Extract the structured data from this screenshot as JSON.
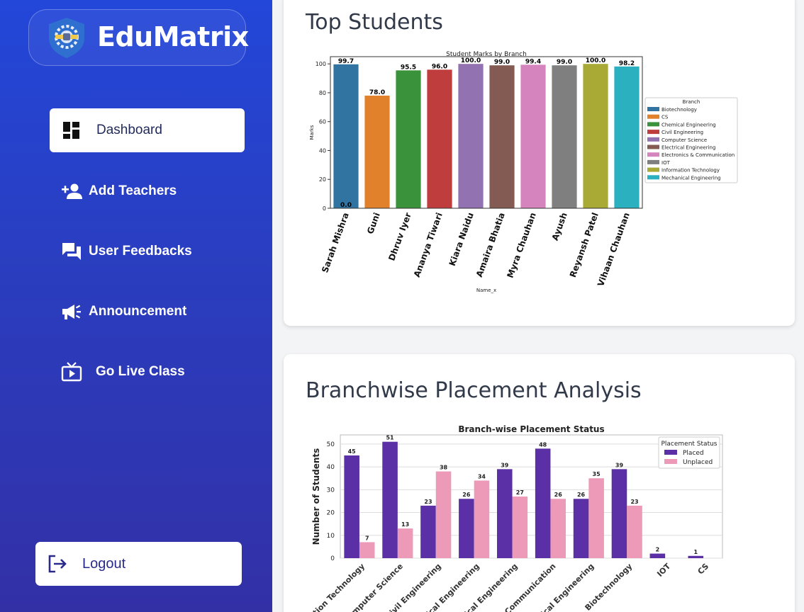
{
  "app": {
    "name": "EduMatrix"
  },
  "sidebar": {
    "items": [
      {
        "label": "Dashboard",
        "icon": "dashboard-icon"
      },
      {
        "label": "Add Teachers",
        "icon": "add-person-icon"
      },
      {
        "label": "User Feedbacks",
        "icon": "chat-icon"
      },
      {
        "label": "Announcement",
        "icon": "megaphone-icon"
      },
      {
        "label": "Go Live Class",
        "icon": "live-tv-icon"
      }
    ],
    "logout_label": "Logout"
  },
  "sections": {
    "top_students_title": "Top Students",
    "placement_title": "Branchwise Placement Analysis"
  },
  "colors": {
    "placed": "#5b30a6",
    "unplaced": "#ec9ab8",
    "sidebar_top": "#2347d9",
    "sidebar_bottom": "#3330a6"
  },
  "chart_data": [
    {
      "type": "bar",
      "title": "Student Marks by Branch",
      "xlabel": "Name_x",
      "ylabel": "Marks",
      "ylim": [
        0,
        105
      ],
      "yticks": [
        0,
        20,
        40,
        60,
        80,
        100
      ],
      "categories": [
        "Sarah Mishra",
        "Guni",
        "Dhruv Iyer",
        "Ananya Tiwari",
        "Kiara Naidu",
        "Amaira Bhatia",
        "Myra Chauhan",
        "Ayush",
        "Reyansh Patel",
        "Vihaan Chauhan"
      ],
      "values": [
        99.7,
        78.0,
        95.5,
        96.0,
        100.0,
        99.0,
        99.4,
        99.0,
        100.0,
        98.2
      ],
      "value_labels": [
        "99.7",
        "78.0",
        "95.5",
        "96.0",
        "100.0",
        "99.0",
        "99.4",
        "99.0",
        "100.0",
        "98.2"
      ],
      "extra_label": "0.0",
      "legend_title": "Branch",
      "legend_position": "right",
      "series_colors": [
        "#3174a1",
        "#e1812c",
        "#3a923a",
        "#c03d3e",
        "#9372b2",
        "#845b53",
        "#d684bd",
        "#7f7f7f",
        "#a9aa35",
        "#2ab0bf"
      ],
      "legend": [
        "Biotechnology",
        "CS",
        "Chemical Engineering",
        "Civil Engineering",
        "Computer Science",
        "Electrical Engineering",
        "Electronics & Communication",
        "IOT",
        "Information Technology",
        "Mechanical Engineering"
      ]
    },
    {
      "type": "bar",
      "title": "Branch-wise Placement Status",
      "ylabel": "Number of Students",
      "ylim": [
        0,
        54
      ],
      "yticks": [
        0,
        10,
        20,
        30,
        40,
        50
      ],
      "grid": true,
      "legend_title": "Placement Status",
      "legend_position": "top-right",
      "categories": [
        "Information Technology",
        "Computer Science",
        "Civil Engineering",
        "Chemical Engineering",
        "Electrical Engineering",
        "Electronics & Communication",
        "Mechanical Engineering",
        "Biotechnology",
        "IOT",
        "CS"
      ],
      "visible_category_labels": [
        "ation Technology",
        "mputer Science",
        "ivil Engineering",
        "ical Engineering",
        "ical Engineering",
        "Communication",
        "ical Engineering",
        "Biotechnology",
        "IOT",
        "CS"
      ],
      "series": [
        {
          "name": "Placed",
          "values": [
            45,
            51,
            23,
            26,
            39,
            48,
            26,
            39,
            2,
            1
          ]
        },
        {
          "name": "Unplaced",
          "values": [
            7,
            13,
            38,
            34,
            27,
            26,
            35,
            23,
            null,
            null
          ]
        }
      ]
    }
  ]
}
